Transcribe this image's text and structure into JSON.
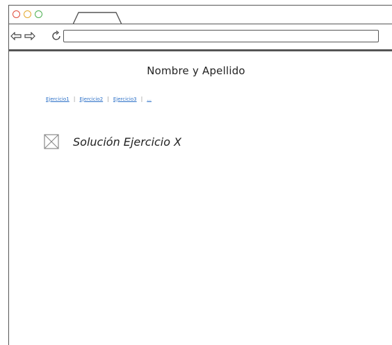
{
  "header": {
    "title": "Nombre y Apellido"
  },
  "nav": {
    "links": [
      {
        "label": "Ejercicio1"
      },
      {
        "label": "Ejercicio2"
      },
      {
        "label": "Ejercicio3"
      },
      {
        "label": "..."
      }
    ]
  },
  "main": {
    "section_title": "Solución Ejercicio X",
    "image_icon": "image-placeholder-icon"
  },
  "browser": {
    "back_icon": "back-arrow-icon",
    "forward_icon": "forward-arrow-icon",
    "reload_icon": "reload-icon"
  },
  "colors": {
    "close": "#e04a3a",
    "minimize": "#e3a82b",
    "maximize": "#4caf50",
    "link": "#2a6fc7",
    "frame": "#555555"
  }
}
